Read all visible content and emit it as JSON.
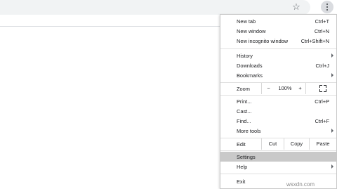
{
  "toolbar": {
    "star_icon": "star-icon",
    "menu_icon": "kebab-menu-icon"
  },
  "menu": {
    "group1": [
      {
        "label": "New tab",
        "shortcut": "Ctrl+T"
      },
      {
        "label": "New window",
        "shortcut": "Ctrl+N"
      },
      {
        "label": "New incognito window",
        "shortcut": "Ctrl+Shift+N"
      }
    ],
    "group2": [
      {
        "label": "History",
        "shortcut": ""
      },
      {
        "label": "Downloads",
        "shortcut": "Ctrl+J"
      },
      {
        "label": "Bookmarks",
        "shortcut": ""
      }
    ],
    "zoom": {
      "label": "Zoom",
      "minus": "−",
      "value": "100%",
      "plus": "+"
    },
    "group3": [
      {
        "label": "Print...",
        "shortcut": "Ctrl+P"
      },
      {
        "label": "Cast...",
        "shortcut": ""
      },
      {
        "label": "Find...",
        "shortcut": "Ctrl+F"
      },
      {
        "label": "More tools",
        "shortcut": ""
      }
    ],
    "edit": {
      "label": "Edit",
      "cut": "Cut",
      "copy": "Copy",
      "paste": "Paste"
    },
    "group4": [
      {
        "label": "Settings",
        "shortcut": ""
      },
      {
        "label": "Help",
        "shortcut": ""
      }
    ],
    "exit": {
      "label": "Exit"
    }
  },
  "watermark": "wsxdn.com"
}
